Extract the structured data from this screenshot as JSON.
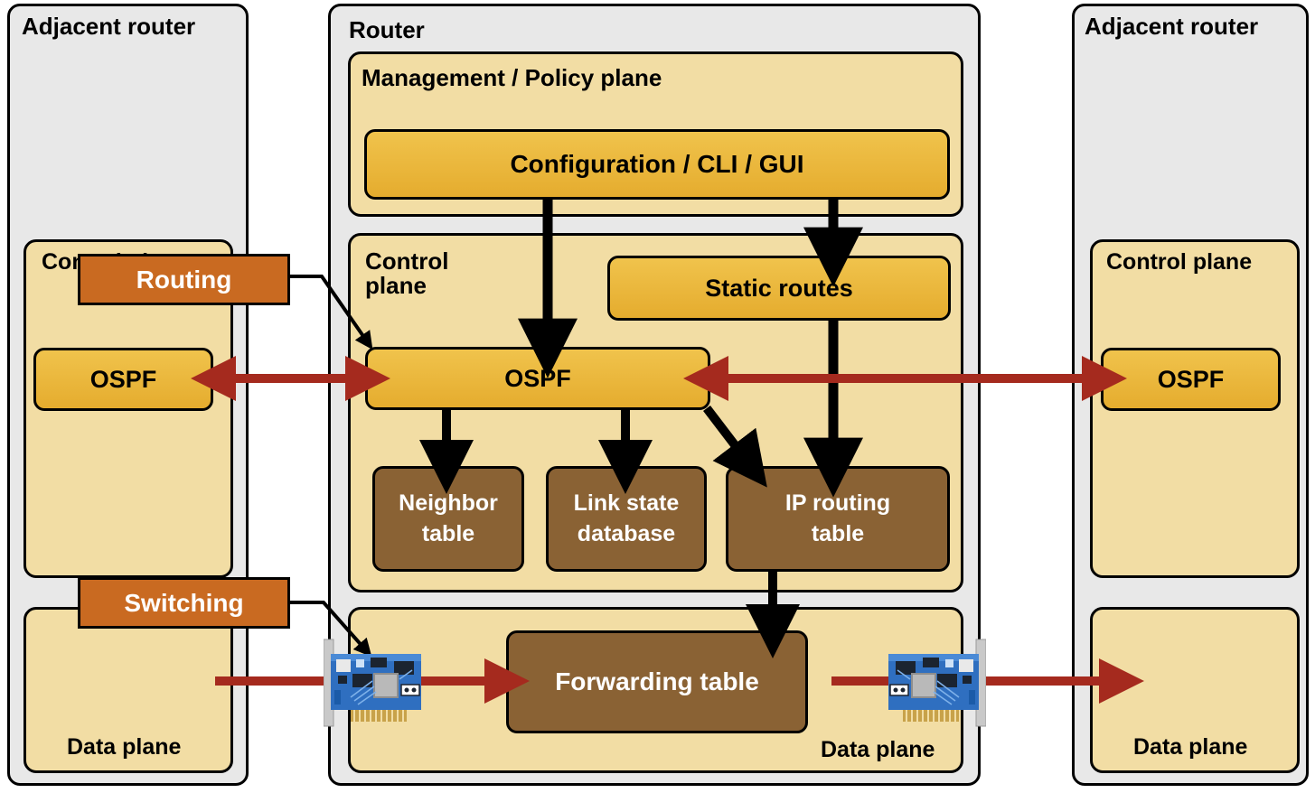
{
  "colors": {
    "shell_fill": "#e8e8e8",
    "plane_fill": "#f2dda4",
    "gold_fill": "#edb83c",
    "brown_fill": "#8a6234",
    "callout_fill": "#c96a21",
    "flow_arrow": "#a52a1e",
    "stroke": "#000000",
    "nic_board": "#2f6fc0",
    "nic_bracket": "#c9c9c9",
    "nic_pins": "#c8a24a"
  },
  "left_router": {
    "title": "Adjacent router",
    "control_plane_label": "Control plane",
    "ospf_label": "OSPF",
    "data_plane_label": "Data plane"
  },
  "center_router": {
    "title": "Router",
    "management_plane": {
      "label": "Management / Policy plane",
      "config_box": "Configuration / CLI / GUI"
    },
    "control_plane": {
      "label": "Control\nplane",
      "static_routes": "Static routes",
      "ospf": "OSPF",
      "tables": [
        {
          "label": "Neighbor\ntable"
        },
        {
          "label": "Link state\ndatabase"
        },
        {
          "label": "IP routing\ntable"
        }
      ]
    },
    "data_plane": {
      "label": "Data plane",
      "forwarding_table": "Forwarding table",
      "left_nic": "network-interface-card",
      "right_nic": "network-interface-card"
    }
  },
  "right_router": {
    "title": "Adjacent router",
    "control_plane_label": "Control plane",
    "ospf_label": "OSPF",
    "data_plane_label": "Data plane"
  },
  "callouts": [
    {
      "label": "Routing"
    },
    {
      "label": "Switching"
    }
  ]
}
